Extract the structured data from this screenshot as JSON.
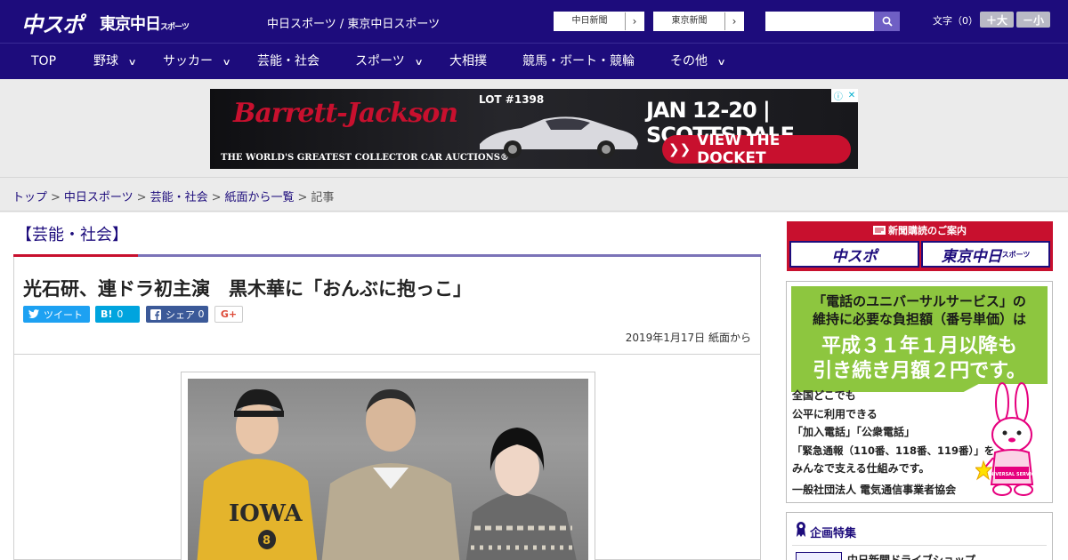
{
  "header": {
    "logo_main": "中スポ",
    "logo_tokyo": "東京中日",
    "logo_tokyo_sub": "スポーツ",
    "site_title": "中日スポーツ / 東京中日スポーツ",
    "ext_links": [
      {
        "label": "中日新聞",
        "arrow": "›"
      },
      {
        "label": "東京新聞",
        "arrow": "›"
      }
    ],
    "search_placeholder": "",
    "font_label": "文字（0）",
    "font_up": "＋大",
    "font_down": "－小"
  },
  "nav": {
    "items": [
      {
        "label": "TOP"
      },
      {
        "label": "野球",
        "chevron": "∨"
      },
      {
        "label": "サッカー",
        "chevron": "∨"
      },
      {
        "label": "芸能・社会"
      },
      {
        "label": "スポーツ",
        "chevron": "∨"
      },
      {
        "label": "大相撲"
      },
      {
        "label": "競馬・ボート・競輪"
      },
      {
        "label": "その他",
        "chevron": "∨"
      }
    ]
  },
  "ad_banner": {
    "brand": "Barrett-Jackson",
    "tagline": "THE WORLD'S GREATEST COLLECTOR CAR AUCTIONS®",
    "lot": "LOT #1398",
    "dates": "JAN 12-20 | SCOTTSDALE",
    "cta": "VIEW THE DOCKET",
    "cta_arrows": "❯❯",
    "choices_i": "ⓘ",
    "choices_x": "✕"
  },
  "breadcrumb": {
    "items": [
      "トップ",
      "中日スポーツ",
      "芸能・社会",
      "紙面から一覧"
    ],
    "current": "記事",
    "separator": ">"
  },
  "article": {
    "category": "【芸能・社会】",
    "headline": "光石研、連ドラ初主演　黒木華に「おんぶに抱っこ」",
    "share": {
      "tweet": "ツイート",
      "hatena_icon": "B!",
      "hatena_count": "0",
      "facebook_label": "シェア",
      "facebook_count": "0",
      "gplus": "G+"
    },
    "date": "2019年1月17日",
    "source": "紙面から",
    "photo_text": "IOWA",
    "photo_number": "8"
  },
  "sidebar": {
    "subscription_title": "新聞購読のご案内",
    "subscription_btns": [
      {
        "label": "中スポ"
      },
      {
        "label": "東京中日",
        "sub": "スポーツ"
      }
    ],
    "ad": {
      "line1": "「電話のユニバーサルサービス」の",
      "line2": "維持に必要な負担額（番号単価）は",
      "line3": "平成３１年１月以降も",
      "line4": "引き続き月額２円です。",
      "list": [
        "全国どこでも",
        "公平に利用できる",
        "「加入電話」「公衆電話」",
        "「緊急通報（110番、118番、119番）」を",
        "みんなで支える仕組みです。"
      ],
      "org": "一般社団法人 電気通信事業者協会",
      "mascot_label": "UNIVERSAL SERVICE"
    },
    "feature_title": "企画特集",
    "feature_item": "中日新聞ドライブショップ"
  },
  "colors": {
    "brand_navy": "#1d0c7c",
    "accent_red": "#c8102e",
    "ad_green": "#8dc63f"
  }
}
